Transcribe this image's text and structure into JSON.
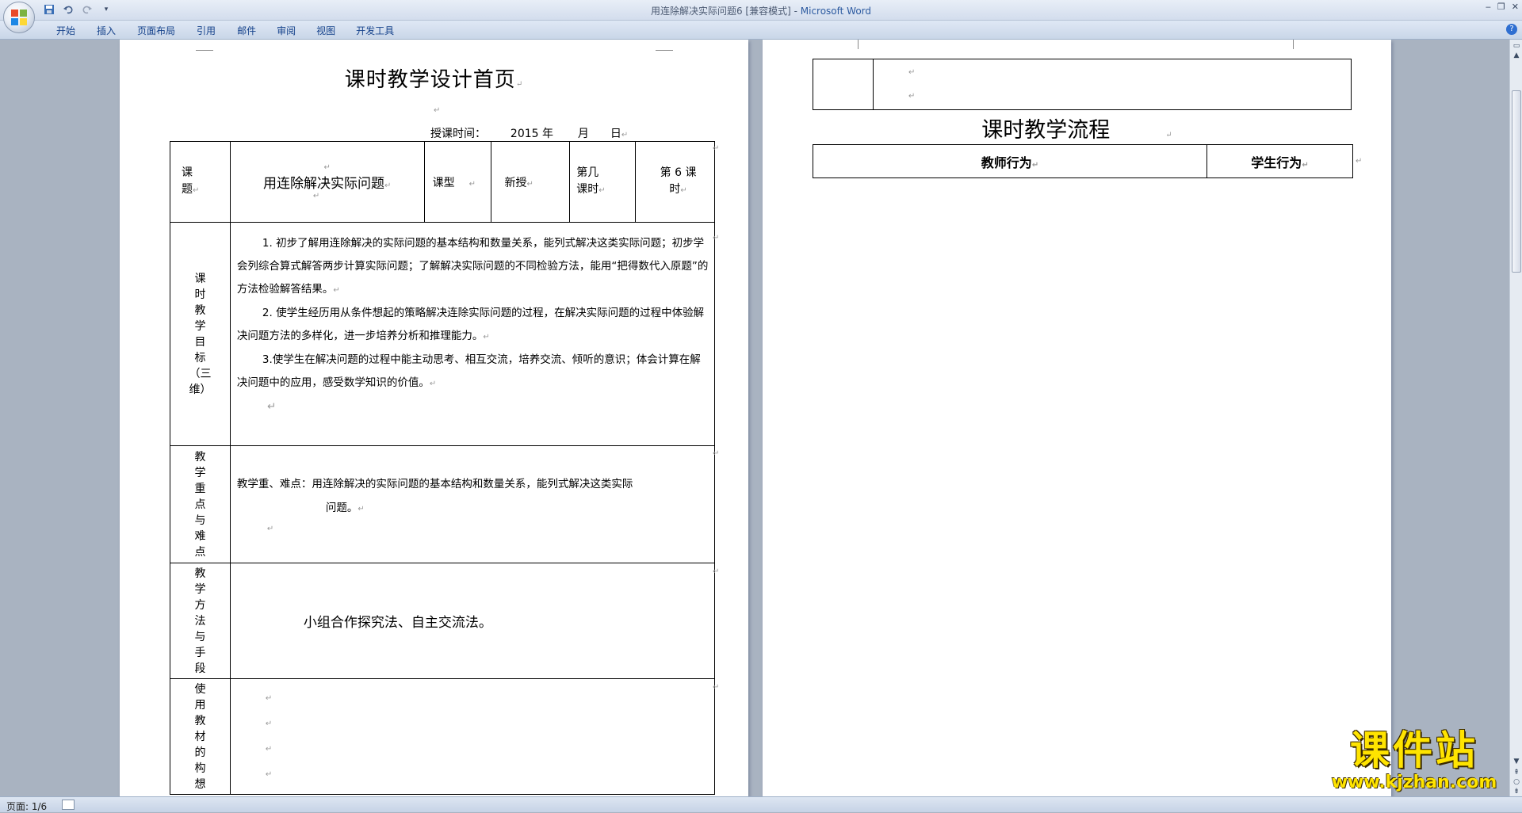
{
  "window": {
    "title_doc": "用连除解决实际问题6 [兼容模式] - ",
    "title_app": "Microsoft Word"
  },
  "quick_access": {
    "save_icon": "save-icon",
    "undo_icon": "undo-icon",
    "redo_icon": "redo-icon",
    "more": "▾"
  },
  "ribbon": {
    "tabs": [
      "开始",
      "插入",
      "页面布局",
      "引用",
      "邮件",
      "审阅",
      "视图",
      "开发工具"
    ]
  },
  "page1": {
    "title": "课时教学设计首页",
    "date_label": "授课时间：",
    "date_year": "2015 年",
    "date_month": "月",
    "date_day": "日",
    "header_row": {
      "c1": "课\n题",
      "topic": "用连除解决实际问题",
      "type_label": "课型",
      "type_value": "新授",
      "period_label": "第几\n课时",
      "period_value": "第 6 课\n时"
    },
    "goals_label": "课\n时\n教\n学\n目\n标\n（三\n维）",
    "goals": [
      "1. 初步了解用连除解决的实际问题的基本结构和数量关系，能列式解决这类实际问题；初步学会列综合算式解答两步计算实际问题；了解解决实际问题的不同检验方法，能用“把得数代入原题”的方法检验解答结果。",
      "2. 使学生经历用从条件想起的策略解决连除实际问题的过程，在解决实际问题的过程中体验解决问题方法的多样化，进一步培养分析和推理能力。",
      "3.使学生在解决问题的过程中能主动思考、相互交流，培养交流、倾听的意识；体会计算在解决问题中的应用，感受数学知识的价值。"
    ],
    "key_label": "教\n学\n重\n点\n与\n难\n点",
    "key_prefix": "教学重、难点：",
    "key_text": "用连除解决的实际问题的基本结构和数量关系，能列式解决这类实际",
    "key_text2": "问题。",
    "method_label": "教\n学\n方\n法\n与\n手\n段",
    "method_text": "小组合作探究法、自主交流法。",
    "material_label": "使\n用\n教\n材\n的\n构\n想"
  },
  "page2": {
    "flow_title": "课时教学流程",
    "col_teacher": "教师行为",
    "col_student": "学生行为"
  },
  "status": {
    "page": "页面: 1/6"
  },
  "watermark": {
    "big": "课件站",
    "url": "www.kjzhan.com"
  }
}
